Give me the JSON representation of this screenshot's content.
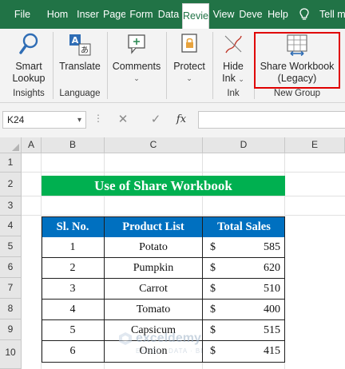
{
  "tabs": [
    {
      "label": "File",
      "active": false
    },
    {
      "label": "Hom",
      "active": false
    },
    {
      "label": "Inser",
      "active": false
    },
    {
      "label": "Page",
      "active": false
    },
    {
      "label": "Form",
      "active": false
    },
    {
      "label": "Data",
      "active": false
    },
    {
      "label": "Revie",
      "active": true
    },
    {
      "label": "View",
      "active": false
    },
    {
      "label": "Deve",
      "active": false
    },
    {
      "label": "Help",
      "active": false
    },
    {
      "label": "Tell m",
      "active": false
    }
  ],
  "ribbon": {
    "smart_lookup": {
      "line1": "Smart",
      "line2": "Lookup"
    },
    "translate": {
      "label": "Translate"
    },
    "comments": {
      "label": "Comments"
    },
    "protect": {
      "label": "Protect"
    },
    "hide_ink": {
      "line1": "Hide",
      "line2": "Ink"
    },
    "share_workbook": {
      "line1": "Share Workbook",
      "line2": "(Legacy)"
    },
    "groups": {
      "insights": "Insights",
      "language": "Language",
      "ink": "Ink",
      "new_group": "New Group"
    }
  },
  "formula_bar": {
    "name_box": "K24",
    "formula": "",
    "fx": "fx",
    "dots": "⋮"
  },
  "columns": [
    "A",
    "B",
    "C",
    "D",
    "E"
  ],
  "rows": [
    "1",
    "2",
    "3",
    "4",
    "5",
    "6",
    "7",
    "8",
    "9",
    "10"
  ],
  "sheet": {
    "title": "Use of Share Workbook",
    "headers": [
      "Sl. No.",
      "Product List",
      "Total Sales"
    ],
    "currency": "$",
    "data": [
      {
        "sl": "1",
        "product": "Potato",
        "sales": "585"
      },
      {
        "sl": "2",
        "product": "Pumpkin",
        "sales": "620"
      },
      {
        "sl": "3",
        "product": "Carrot",
        "sales": "510"
      },
      {
        "sl": "4",
        "product": "Tomato",
        "sales": "400"
      },
      {
        "sl": "5",
        "product": "Capsicum",
        "sales": "515"
      },
      {
        "sl": "6",
        "product": "Onion",
        "sales": "415"
      }
    ]
  },
  "watermark": {
    "name": "exceldemy",
    "sub": "EXCEL · DATA · BI"
  },
  "colors": {
    "tab_bar": "#217346",
    "title_fill": "#00b050",
    "header_fill": "#0070c0",
    "highlight": "#e00000"
  }
}
